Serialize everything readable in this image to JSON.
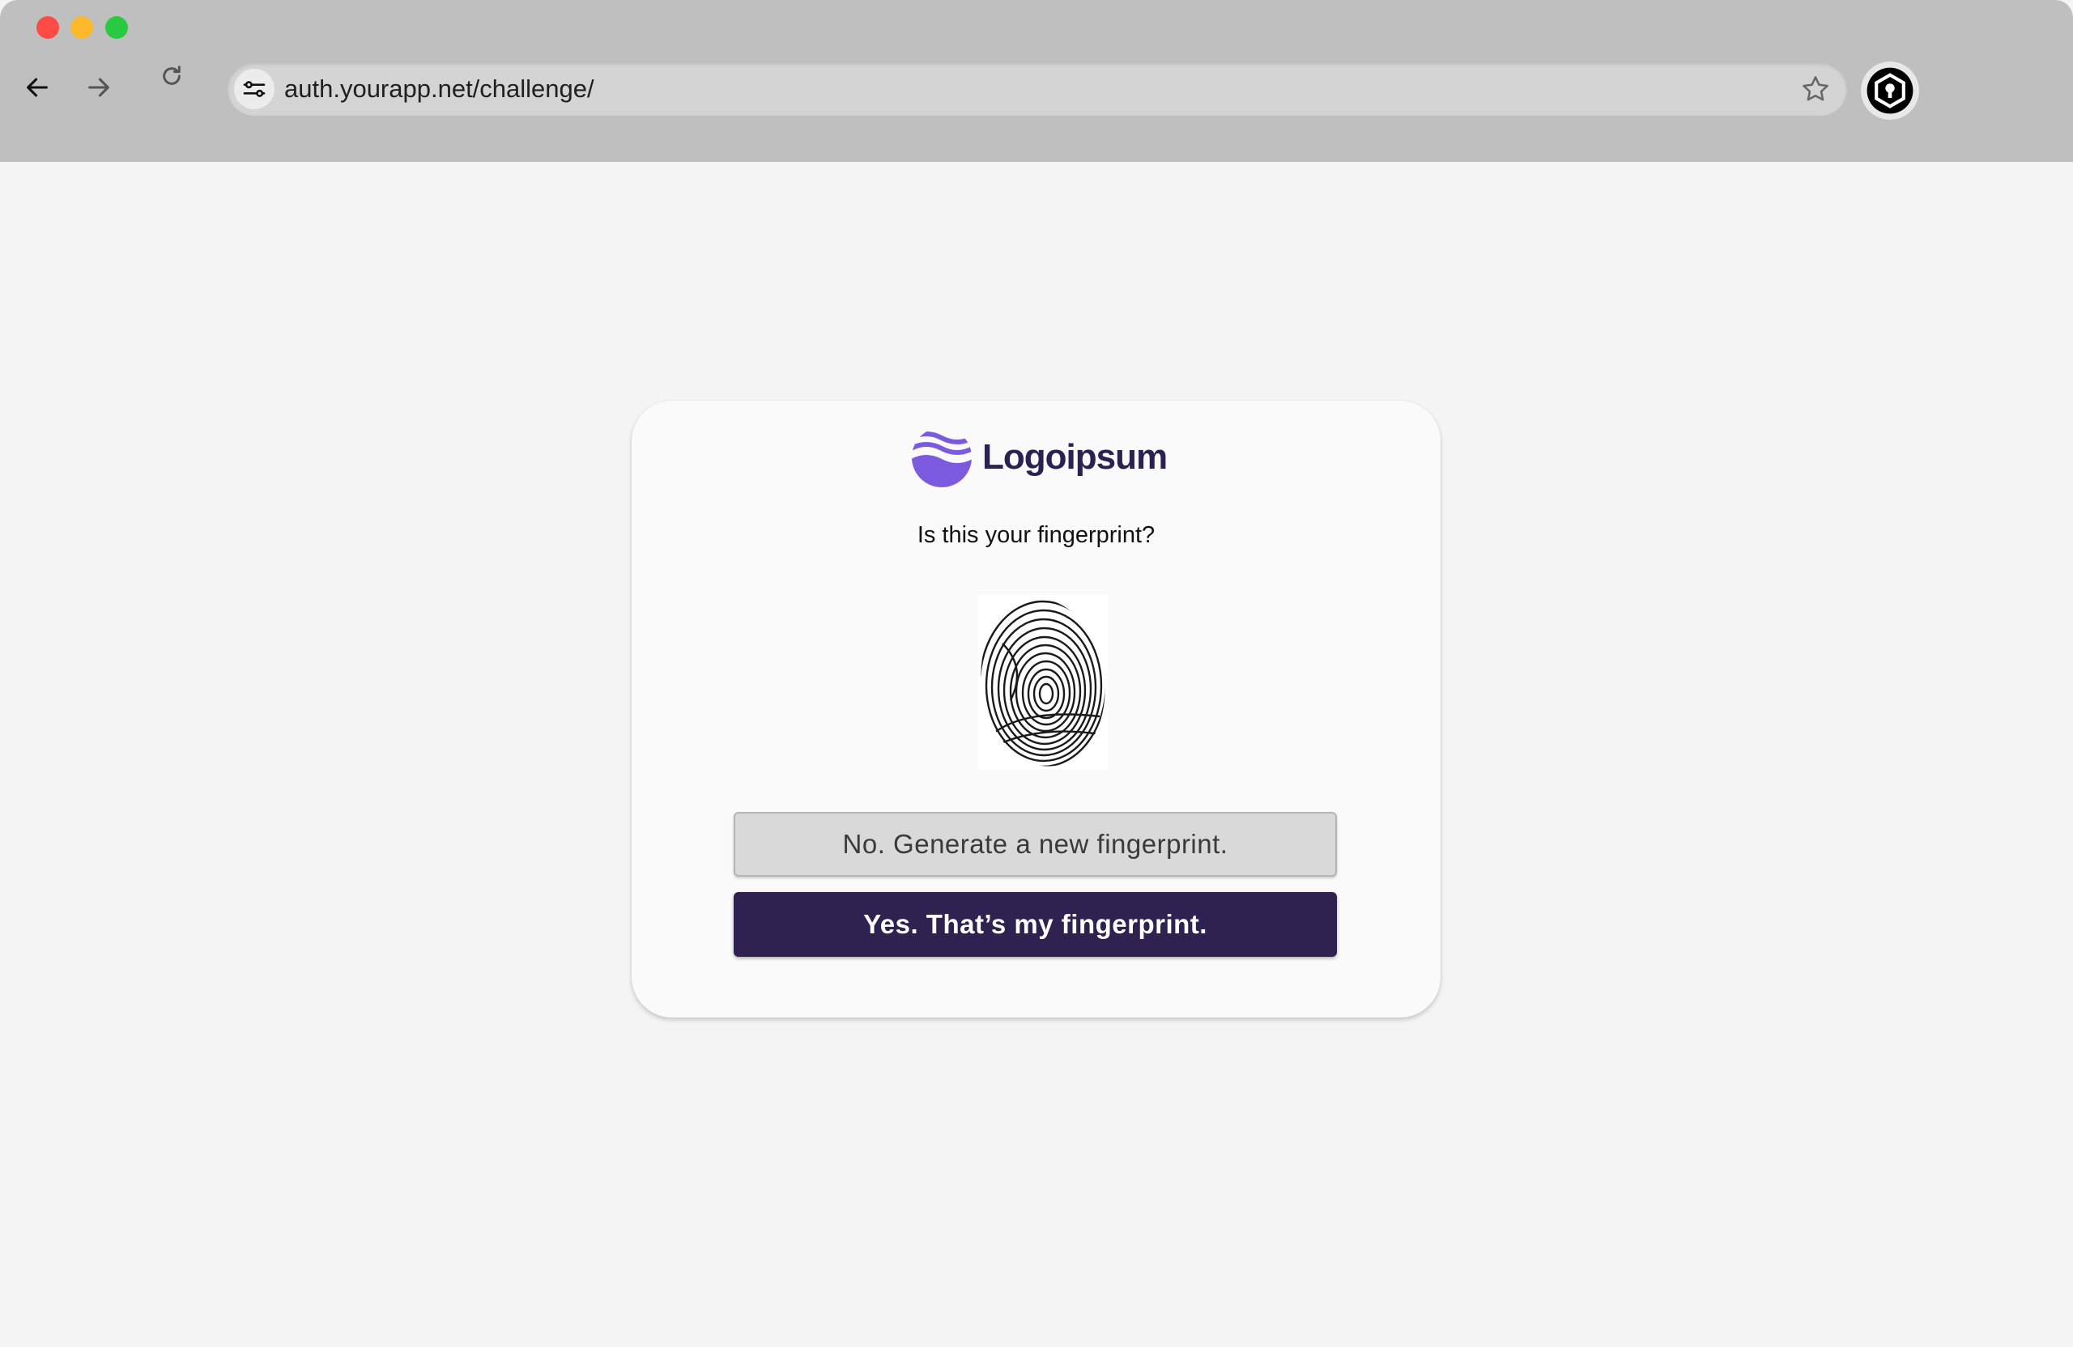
{
  "browser": {
    "url": "auth.yourapp.net/challenge/",
    "icons": {
      "back": "arrow-left-icon",
      "forward": "arrow-right-icon",
      "reload": "reload-icon",
      "site_info": "tune-icon",
      "bookmark": "star-icon",
      "extension": "shield-lock-icon"
    }
  },
  "card": {
    "brand": {
      "name": "Logoipsum",
      "color": "#2c2150",
      "mark_color": "#7b5ae0"
    },
    "question": "Is this your fingerprint?",
    "buttons": {
      "no_label": "No. Generate a new fingerprint.",
      "yes_label": "Yes. That’s my fingerprint."
    },
    "accent_color": "#2f2150"
  }
}
